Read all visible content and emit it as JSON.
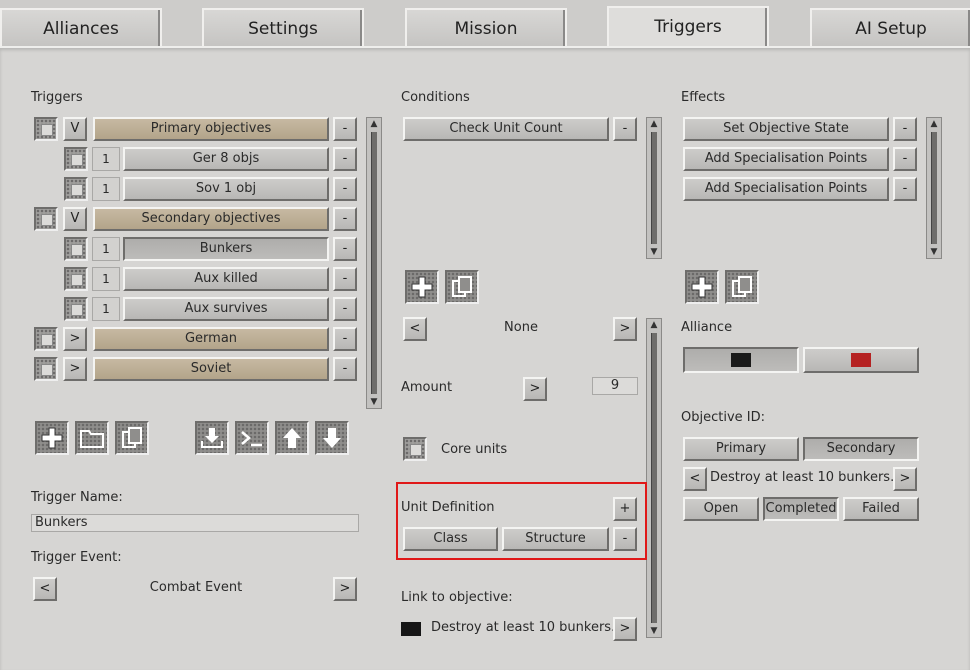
{
  "tabs": [
    "Alliances",
    "Settings",
    "Mission",
    "Triggers",
    "AI Setup"
  ],
  "active_tab": "Triggers",
  "triggers": {
    "title": "Triggers",
    "items": [
      {
        "label": "Primary objectives",
        "toggle": "V",
        "kind": "group"
      },
      {
        "label": "Ger 8 objs",
        "count": "1",
        "kind": "child"
      },
      {
        "label": "Sov 1 obj",
        "count": "1",
        "kind": "child"
      },
      {
        "label": "Secondary objectives",
        "toggle": "V",
        "kind": "group"
      },
      {
        "label": "Bunkers",
        "count": "1",
        "kind": "child",
        "selected": true
      },
      {
        "label": "Aux killed",
        "count": "1",
        "kind": "child"
      },
      {
        "label": "Aux survives",
        "count": "1",
        "kind": "child"
      },
      {
        "label": "German",
        "toggle": ">",
        "kind": "group"
      },
      {
        "label": "Soviet",
        "toggle": ">",
        "kind": "group"
      }
    ],
    "remove_symbol": "-",
    "trigger_name_label": "Trigger Name:",
    "trigger_name_value": "Bunkers",
    "trigger_event_label": "Trigger Event:",
    "trigger_event_value": "Combat Event",
    "prev_symbol": "<",
    "next_symbol": ">"
  },
  "conditions": {
    "title": "Conditions",
    "items": [
      "Check Unit Count"
    ],
    "selector_value": "None",
    "amount_label": "Amount",
    "amount_value": "9",
    "core_units_label": "Core units",
    "unit_definition_label": "Unit Definition",
    "class_label": "Class",
    "structure_label": "Structure",
    "add_symbol": "+",
    "remove_symbol": "-",
    "link_label": "Link to objective:",
    "link_value": "Destroy at least 10 bunkers."
  },
  "effects": {
    "title": "Effects",
    "items": [
      "Set Objective State",
      "Add Specialisation Points",
      "Add Specialisation Points"
    ],
    "alliance_label": "Alliance",
    "alliance_colors": [
      "#1a1a1a",
      "#b52222"
    ],
    "objective_id_label": "Objective ID:",
    "primary_label": "Primary",
    "secondary_label": "Secondary",
    "objective_text": "Destroy at least 10 bunkers.",
    "open_label": "Open",
    "completed_label": "Completed",
    "failed_label": "Failed"
  },
  "colors": {
    "highlight": "#e01818",
    "objective_row": "#c2b49c",
    "link_swatch": "#161616"
  }
}
